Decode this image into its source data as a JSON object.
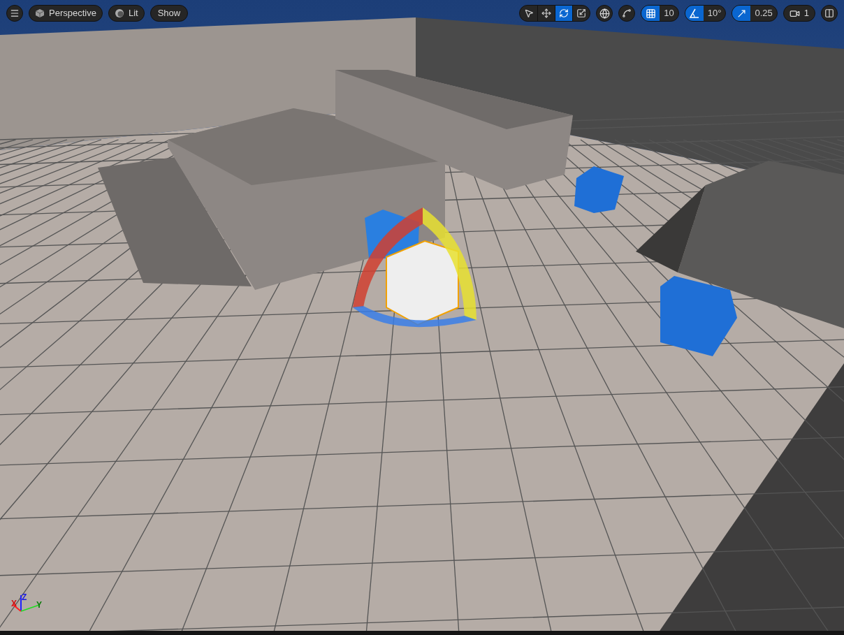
{
  "viewport_toolbar": {
    "left": [
      {
        "kind": "menu"
      },
      {
        "kind": "perspective",
        "label": "Perspective"
      },
      {
        "kind": "lit",
        "label": "Lit"
      },
      {
        "kind": "plain",
        "label": "Show"
      }
    ],
    "transform_tools": [
      {
        "kind": "select",
        "selected": false
      },
      {
        "kind": "translate",
        "selected": false
      },
      {
        "kind": "rotate",
        "selected": true
      },
      {
        "kind": "scale",
        "selected": false
      }
    ],
    "toggles": [
      {
        "kind": "world"
      },
      {
        "kind": "surface"
      }
    ],
    "snaps": [
      {
        "kind": "grid",
        "on": true,
        "value": "10"
      },
      {
        "kind": "rotation",
        "on": true,
        "value": "10°"
      },
      {
        "kind": "scale",
        "on": true,
        "value": "0.25"
      }
    ],
    "camera_speed": "1"
  },
  "axis_indicator": {
    "x": "X",
    "y": "Y",
    "z": "Z"
  }
}
